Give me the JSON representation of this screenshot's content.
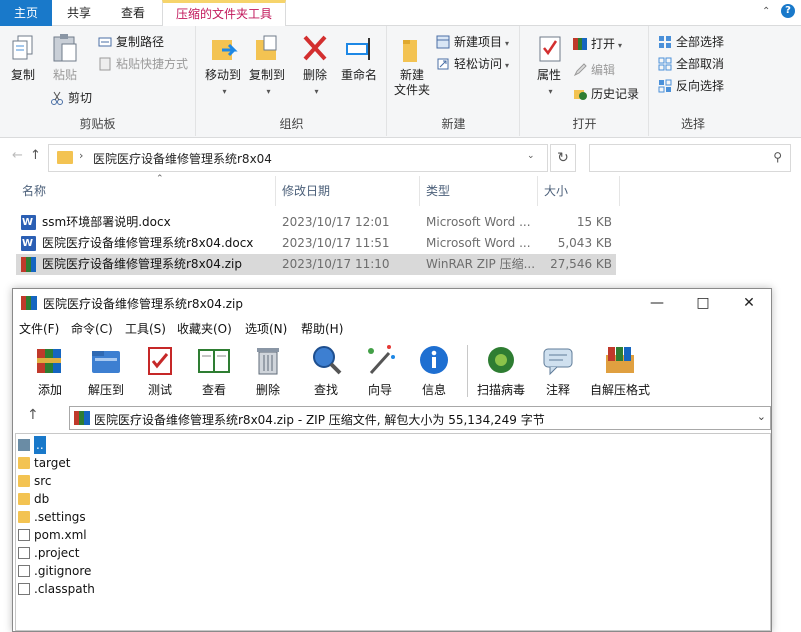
{
  "ribbon": {
    "tabs": [
      "主页",
      "共享",
      "查看",
      "压缩的文件夹工具"
    ],
    "clipboard": {
      "copy": "复制",
      "paste": "粘贴",
      "copy_path": "复制路径",
      "paste_shortcut": "粘贴快捷方式",
      "cut": "剪切",
      "label": "剪贴板"
    },
    "organize": {
      "move_to": "移动到",
      "copy_to": "复制到",
      "delete": "删除",
      "rename": "重命名",
      "label": "组织"
    },
    "new": {
      "new_folder_line1": "新建",
      "new_folder_line2": "文件夹",
      "new_item": "新建项目",
      "easy_access": "轻松访问",
      "label": "新建"
    },
    "open": {
      "properties": "属性",
      "open": "打开",
      "edit": "编辑",
      "history": "历史记录",
      "label": "打开"
    },
    "select": {
      "select_all": "全部选择",
      "select_none": "全部取消",
      "invert": "反向选择",
      "label": "选择"
    }
  },
  "address": {
    "path": "医院医疗设备维修管理系统r8x04",
    "search_placeholder": ""
  },
  "files": {
    "columns": [
      "名称",
      "修改日期",
      "类型",
      "大小"
    ],
    "rows": [
      {
        "name": "ssm环境部署说明.docx",
        "date": "2023/10/17 12:01",
        "type": "Microsoft Word ...",
        "size": "15 KB",
        "icon": "word-icon"
      },
      {
        "name": "医院医疗设备维修管理系统r8x04.docx",
        "date": "2023/10/17 11:51",
        "type": "Microsoft Word ...",
        "size": "5,043 KB",
        "icon": "word-icon"
      },
      {
        "name": "医院医疗设备维修管理系统r8x04.zip",
        "date": "2023/10/17 11:10",
        "type": "WinRAR ZIP 压缩...",
        "size": "27,546 KB",
        "icon": "winrar-icon"
      }
    ]
  },
  "winrar": {
    "title": "医院医疗设备维修管理系统r8x04.zip",
    "menu": [
      "文件(F)",
      "命令(C)",
      "工具(S)",
      "收藏夹(O)",
      "选项(N)",
      "帮助(H)"
    ],
    "toolbar": [
      "添加",
      "解压到",
      "测试",
      "查看",
      "删除",
      "查找",
      "向导",
      "信息",
      "扫描病毒",
      "注释",
      "自解压格式"
    ],
    "path": "医院医疗设备维修管理系统r8x04.zip - ZIP 压缩文件, 解包大小为 55,134,249 字节",
    "items": [
      {
        "name": "..",
        "kind": "updir"
      },
      {
        "name": "target",
        "kind": "folder"
      },
      {
        "name": "src",
        "kind": "folder"
      },
      {
        "name": "db",
        "kind": "folder"
      },
      {
        "name": ".settings",
        "kind": "folder"
      },
      {
        "name": "pom.xml",
        "kind": "xml"
      },
      {
        "name": ".project",
        "kind": "doc"
      },
      {
        "name": ".gitignore",
        "kind": "doc"
      },
      {
        "name": ".classpath",
        "kind": "doc"
      }
    ]
  }
}
